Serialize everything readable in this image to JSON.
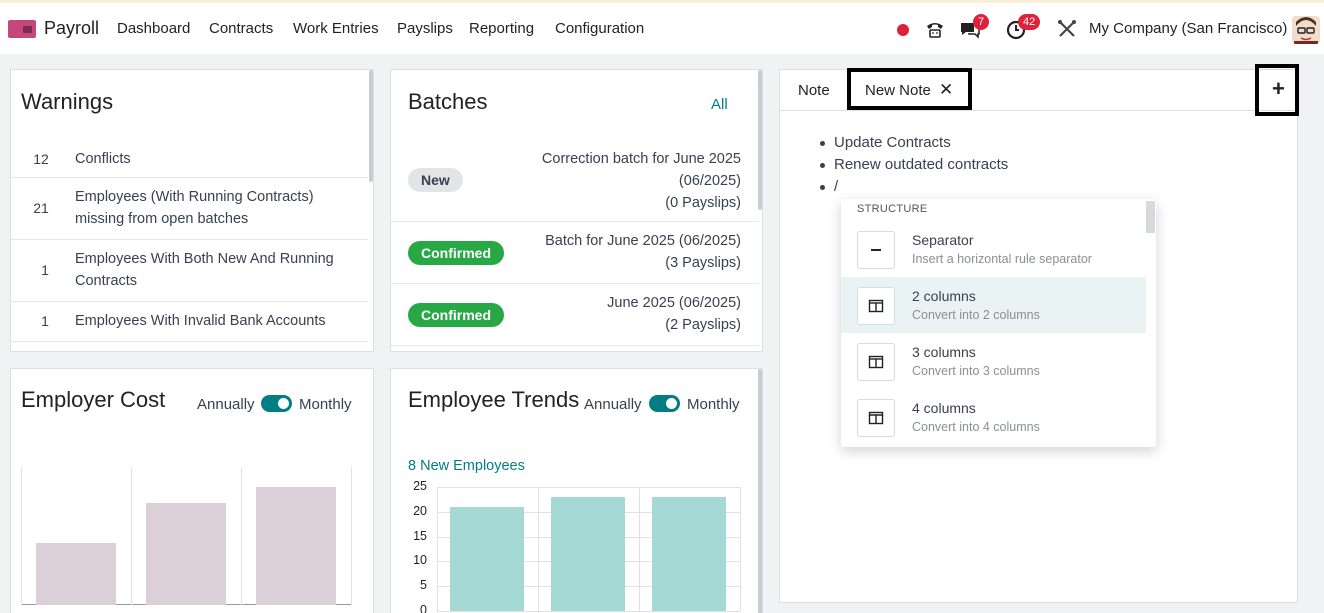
{
  "nav": {
    "app_name": "Payroll",
    "menu": [
      "Dashboard",
      "Contracts",
      "Work Entries",
      "Payslips",
      "Reporting",
      "Configuration"
    ],
    "messages_badge": "7",
    "activities_badge": "42",
    "company": "My Company (San Francisco)"
  },
  "warnings": {
    "title": "Warnings",
    "rows": [
      {
        "count": "12",
        "label": "Conflicts"
      },
      {
        "count": "21",
        "label": "Employees (With Running Contracts) missing from open batches"
      },
      {
        "count": "1",
        "label": "Employees With Both New And Running Contracts"
      },
      {
        "count": "1",
        "label": "Employees With Invalid Bank Accounts"
      }
    ]
  },
  "batches": {
    "title": "Batches",
    "all_link": "All",
    "rows": [
      {
        "status": "New",
        "line1": "Correction batch for June 2025",
        "line2": "(06/2025)",
        "line3": "(0 Payslips)"
      },
      {
        "status": "Confirmed",
        "line1": "Batch for June 2025 (06/2025)",
        "line2": "(3 Payslips)"
      },
      {
        "status": "Confirmed",
        "line1": "June 2025 (06/2025)",
        "line2": "(2 Payslips)"
      }
    ]
  },
  "employer_cost": {
    "title": "Employer Cost",
    "annually": "Annually",
    "monthly": "Monthly"
  },
  "employee_trends": {
    "title": "Employee Trends",
    "annually": "Annually",
    "monthly": "Monthly",
    "subtitle": "8 New Employees"
  },
  "notes": {
    "tabs": [
      "Note",
      "New Note"
    ],
    "items": [
      "Update Contracts",
      "Renew outdated contracts",
      "/"
    ],
    "command_header": "STRUCTURE",
    "commands": [
      {
        "title": "Separator",
        "desc": "Insert a horizontal rule separator",
        "icon": "separator-icon"
      },
      {
        "title": "2 columns",
        "desc": "Convert into 2 columns",
        "icon": "columns-icon"
      },
      {
        "title": "3 columns",
        "desc": "Convert into 3 columns",
        "icon": "columns-icon"
      },
      {
        "title": "4 columns",
        "desc": "Convert into 4 columns",
        "icon": "columns-icon"
      }
    ]
  },
  "chart_data": [
    {
      "type": "bar",
      "title": "Employer Cost",
      "categories": [
        "",
        "",
        ""
      ],
      "values": [
        0.5,
        0.82,
        0.95
      ],
      "color": "#dbd0d7"
    },
    {
      "type": "bar",
      "title": "Employee Trends",
      "categories": [
        "",
        "",
        ""
      ],
      "values": [
        21,
        23,
        23
      ],
      "ylim": [
        0,
        25
      ],
      "yticks": [
        "25",
        "20",
        "15",
        "10",
        "5",
        "0"
      ],
      "grid": true,
      "color": "#a4d9d6"
    }
  ]
}
